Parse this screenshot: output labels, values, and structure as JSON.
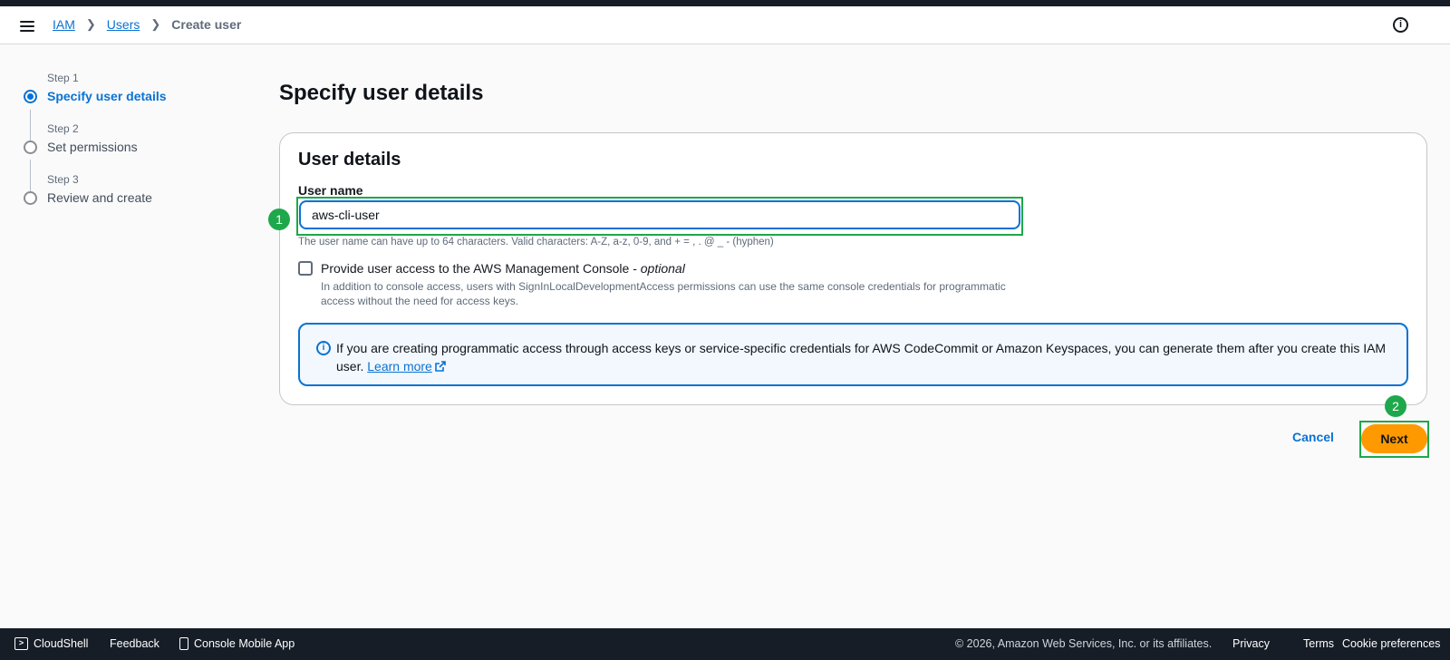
{
  "header": {
    "breadcrumb": [
      "IAM",
      "Users",
      "Create user"
    ]
  },
  "steps": [
    {
      "num": "Step 1",
      "title": "Specify user details"
    },
    {
      "num": "Step 2",
      "title": "Set permissions"
    },
    {
      "num": "Step 3",
      "title": "Review and create"
    }
  ],
  "page_title": "Specify user details",
  "panel": {
    "title": "User details",
    "user_name_label": "User name",
    "user_name_value": "aws-cli-user",
    "user_name_hint": "The user name can have up to 64 characters. Valid characters: A-Z, a-z, 0-9, and + = , . @ _ - (hyphen)",
    "console_access_label": "Provide user access to the AWS Management Console - ",
    "console_access_optional": "optional",
    "console_access_desc": "In addition to console access, users with SignInLocalDevelopmentAccess permissions can use the same console credentials for programmatic access without the need for access keys.",
    "alert_text": "If you are creating programmatic access through access keys or service-specific credentials for AWS CodeCommit or Amazon Keyspaces, you can generate them after you create this IAM user.",
    "alert_link": "Learn more"
  },
  "annotations": [
    "1",
    "2"
  ],
  "actions": {
    "cancel": "Cancel",
    "next": "Next"
  },
  "footer": {
    "cloudshell": "CloudShell",
    "feedback": "Feedback",
    "mobile_app": "Console Mobile App",
    "copyright": "© 2026, Amazon Web Services, Inc. or its affiliates.",
    "privacy": "Privacy",
    "terms": "Terms",
    "cookies": "Cookie preferences"
  },
  "colors": {
    "link_blue": "#0972d3",
    "primary_orange": "#ff9900",
    "annotation_green": "#1ea84b",
    "footer_bg": "#161d26"
  },
  "icons": [
    "hamburger-icon",
    "chevron-right-icon",
    "info-icon",
    "external-link-icon",
    "cloudshell-icon",
    "mobile-phone-icon"
  ]
}
